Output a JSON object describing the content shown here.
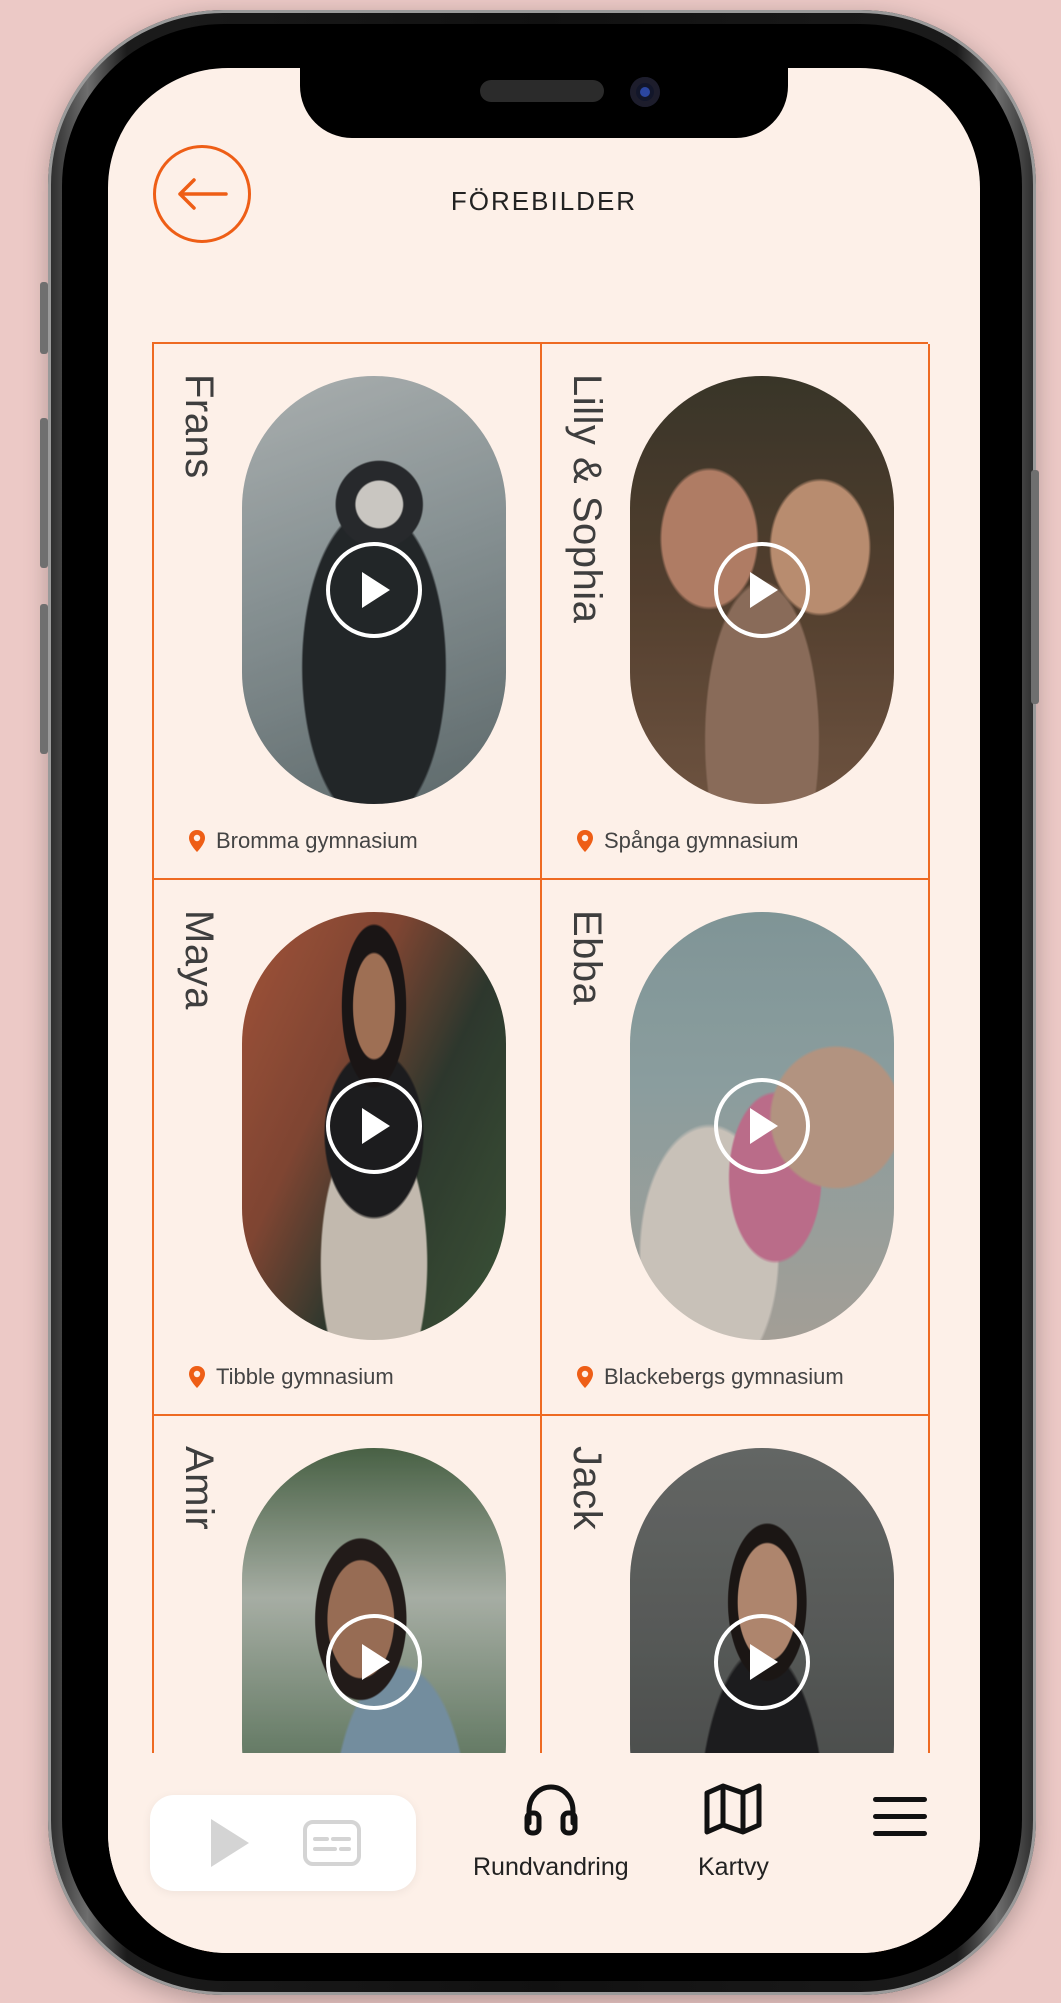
{
  "header": {
    "title": "FÖREBILDER"
  },
  "colors": {
    "accent": "#ee5e16",
    "background": "#fdf0e8",
    "text": "#222222"
  },
  "cards": [
    {
      "name": "Frans",
      "school": "Bromma gymnasium"
    },
    {
      "name": "Lilly & Sophia",
      "school": "Spånga gymnasium"
    },
    {
      "name": "Maya",
      "school": "Tibble gymnasium"
    },
    {
      "name": "Ebba",
      "school": "Blackebergs gymnasium"
    },
    {
      "name": "Amir",
      "school": ""
    },
    {
      "name": "Jack",
      "school": ""
    }
  ],
  "bottom_nav": {
    "tour_label": "Rundvandring",
    "map_label": "Kartvy"
  },
  "icons": {
    "back": "arrow-left-icon",
    "play": "play-icon",
    "location": "map-pin-icon",
    "subtitles": "subtitles-icon",
    "tour": "headphones-icon",
    "map": "map-icon",
    "menu": "hamburger-menu-icon"
  }
}
